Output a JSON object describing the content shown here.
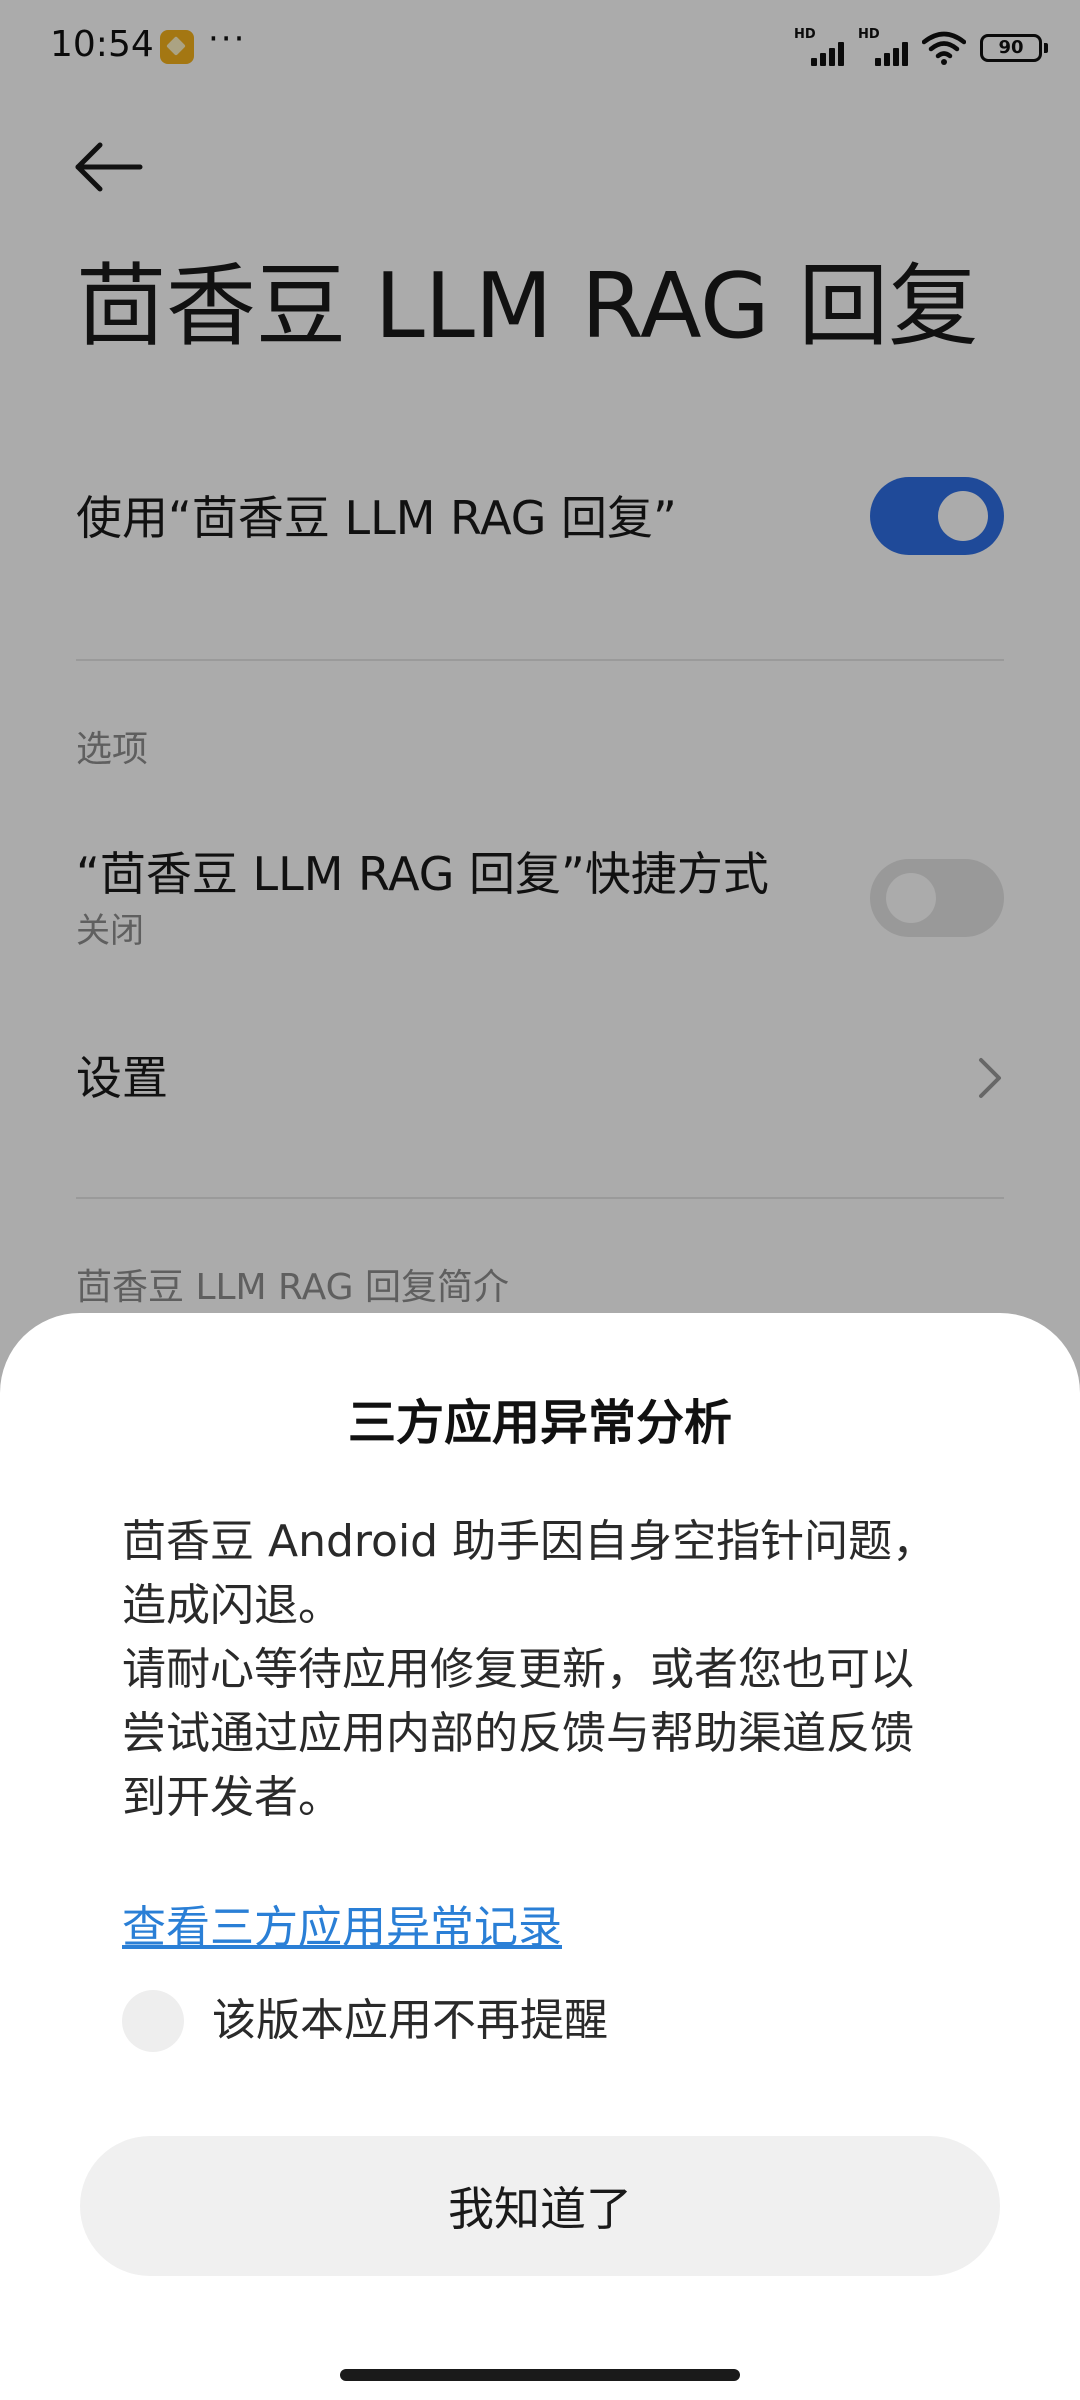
{
  "status_bar": {
    "time": "10:54",
    "more": "···",
    "signal_1_label": "HD",
    "signal_2_label": "HD",
    "battery_level": "90",
    "icons": [
      "notification-app-icon",
      "signal-icon",
      "signal-icon",
      "wifi-icon",
      "battery-icon"
    ]
  },
  "page": {
    "back_icon": "arrow-left-icon",
    "title": "茴香豆 LLM RAG 回复",
    "main_toggle": {
      "label": "使用“茴香豆 LLM RAG 回复”",
      "state": "on"
    },
    "options_header": "选项",
    "shortcut_row": {
      "label": "“茴香豆 LLM RAG 回复”快捷方式",
      "sublabel": "关闭",
      "state": "off"
    },
    "settings_row": {
      "label": "设置",
      "icon": "chevron-right-icon"
    },
    "intro_header": "茴香豆 LLM RAG 回复简介"
  },
  "dialog": {
    "title": "三方应用异常分析",
    "message_line_1": "茴香豆 Android 助手因自身空指针问题，造成闪退。",
    "message_line_2": "请耐心等待应用修复更新，或者您也可以尝试通过应用内部的反馈与帮助渠道反馈到开发者。",
    "link_label": "查看三方应用异常记录",
    "checkbox_label": "该版本应用不再提醒",
    "checkbox_checked": false,
    "ok_label": "我知道了"
  },
  "colors": {
    "accent": "#2f6fe4",
    "link": "#2a7fd6",
    "notification_icon": "#f5b21c"
  }
}
